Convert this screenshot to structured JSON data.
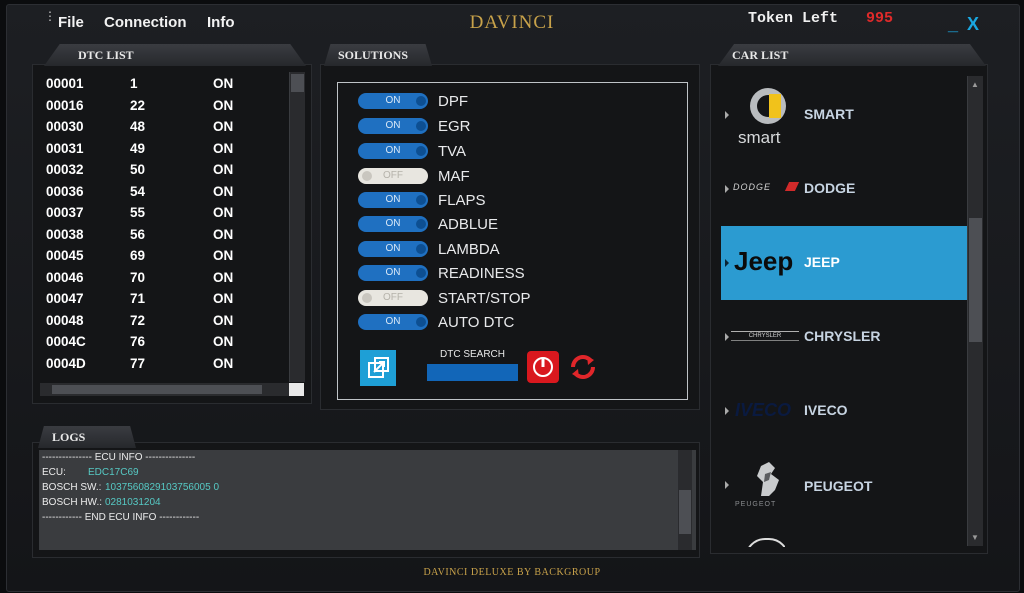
{
  "app": {
    "title": "DAVINCI",
    "token_label": "Token Left",
    "token_value": "995",
    "footer": "DAVINCI DELUXE BY BACKGROUP"
  },
  "menu": {
    "file": "File",
    "connection": "Connection",
    "info": "Info",
    "minimize": "_",
    "close": "X"
  },
  "panels": {
    "dtc_list": "DTC LIST",
    "solutions": "SOLUTIONS",
    "car_list": "CAR LIST",
    "logs": "LOGS"
  },
  "dtc_rows": [
    {
      "code": "00001",
      "num": "1",
      "state": "ON"
    },
    {
      "code": "00016",
      "num": "22",
      "state": "ON"
    },
    {
      "code": "00030",
      "num": "48",
      "state": "ON"
    },
    {
      "code": "00031",
      "num": "49",
      "state": "ON"
    },
    {
      "code": "00032",
      "num": "50",
      "state": "ON"
    },
    {
      "code": "00036",
      "num": "54",
      "state": "ON"
    },
    {
      "code": "00037",
      "num": "55",
      "state": "ON"
    },
    {
      "code": "00038",
      "num": "56",
      "state": "ON"
    },
    {
      "code": "00045",
      "num": "69",
      "state": "ON"
    },
    {
      "code": "00046",
      "num": "70",
      "state": "ON"
    },
    {
      "code": "00047",
      "num": "71",
      "state": "ON"
    },
    {
      "code": "00048",
      "num": "72",
      "state": "ON"
    },
    {
      "code": "0004C",
      "num": "76",
      "state": "ON"
    },
    {
      "code": "0004D",
      "num": "77",
      "state": "ON"
    }
  ],
  "solutions": [
    {
      "label": "DPF",
      "state": "ON"
    },
    {
      "label": "EGR",
      "state": "ON"
    },
    {
      "label": "TVA",
      "state": "ON"
    },
    {
      "label": "MAF",
      "state": "OFF"
    },
    {
      "label": "FLAPS",
      "state": "ON"
    },
    {
      "label": "ADBLUE",
      "state": "ON"
    },
    {
      "label": "LAMBDA",
      "state": "ON"
    },
    {
      "label": "READINESS",
      "state": "ON"
    },
    {
      "label": "START/STOP",
      "state": "OFF"
    },
    {
      "label": "AUTO DTC",
      "state": "ON"
    }
  ],
  "dtc_search": {
    "label": "DTC SEARCH",
    "value": ""
  },
  "logs": [
    {
      "text": "--------------- ECU INFO ---------------",
      "value": ""
    },
    {
      "text": "ECU:",
      "value": "EDC17C69"
    },
    {
      "text": "BOSCH SW.:",
      "value": "1037560829103756005 0"
    },
    {
      "text": "BOSCH HW.:",
      "value": "0281031204"
    },
    {
      "text": "------------ END ECU INFO ------------",
      "value": ""
    }
  ],
  "cars": [
    {
      "name": "SMART",
      "logo_text": "smart",
      "selected": false
    },
    {
      "name": "DODGE",
      "logo_text": "DODGE",
      "selected": false
    },
    {
      "name": "JEEP",
      "logo_text": "Jeep",
      "selected": true
    },
    {
      "name": "CHRYSLER",
      "logo_text": "CHRYSLER",
      "selected": false
    },
    {
      "name": "IVECO",
      "logo_text": "IVECO",
      "selected": false
    },
    {
      "name": "PEUGEOT",
      "logo_text": "PEUGEOT",
      "selected": false
    }
  ],
  "colors": {
    "accent": "#2b9bd1",
    "title_gold": "#c8a24a",
    "token_red": "#e02a2a",
    "toggle_on": "#1f70c1"
  }
}
